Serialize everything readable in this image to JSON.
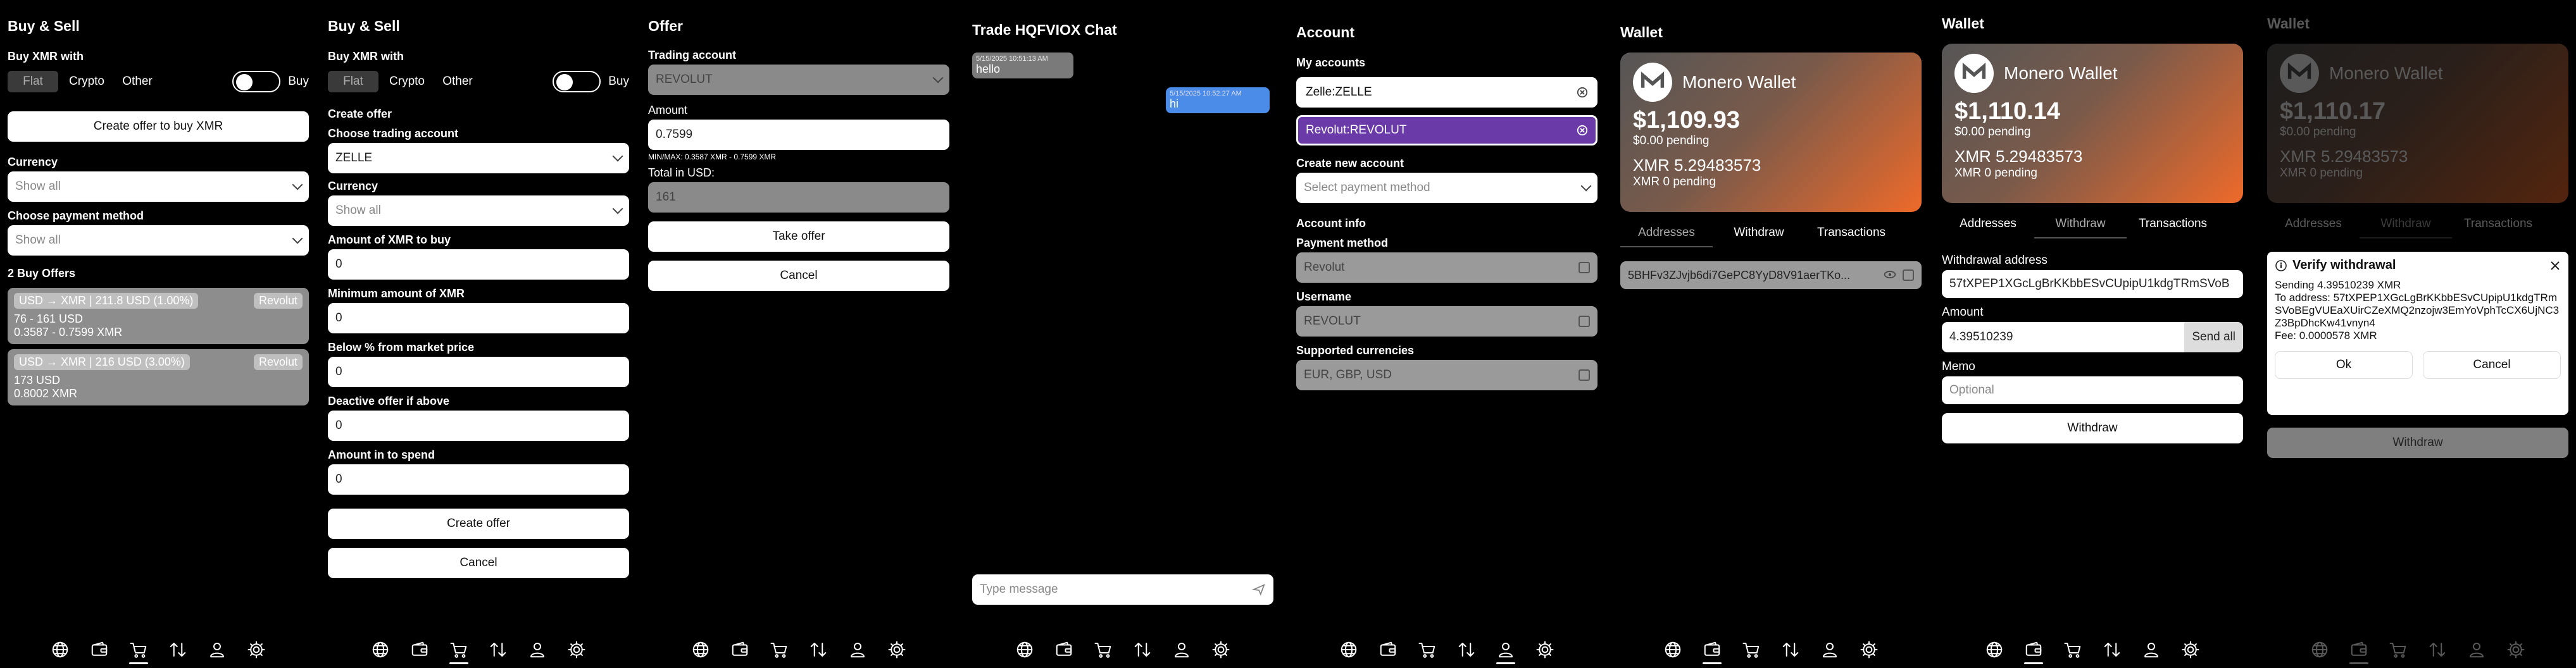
{
  "s1": {
    "title": "Buy & Sell",
    "buy_with": "Buy XMR with",
    "tabs": [
      "Flat",
      "Crypto",
      "Other"
    ],
    "toggle_label": "Buy",
    "create_btn": "Create offer to buy XMR",
    "currency_label": "Currency",
    "currency_value": "Show all",
    "payment_label": "Choose payment method",
    "payment_value": "Show all",
    "offers_title": "2 Buy Offers",
    "offers": [
      {
        "head": "USD → XMR | 211.8 USD (1.00%)",
        "method": "Revolut",
        "range": "76 - 161 USD",
        "xmr": "0.3587 - 0.7599 XMR"
      },
      {
        "head": "USD → XMR | 216 USD (3.00%)",
        "method": "Revolut",
        "range": "173 USD",
        "xmr": "0.8002 XMR"
      }
    ]
  },
  "s2": {
    "title": "Buy & Sell",
    "buy_with": "Buy XMR with",
    "tabs": [
      "Flat",
      "Crypto",
      "Other"
    ],
    "toggle_label": "Buy",
    "create_offer": "Create offer",
    "trading_label": "Choose trading account",
    "trading_value": "ZELLE",
    "currency_label": "Currency",
    "currency_value": "Show all",
    "amount_label": "Amount of XMR to buy",
    "amount_value": "0",
    "min_label": "Minimum amount of XMR",
    "min_value": "0",
    "below_label": "Below % from market price",
    "below_value": "0",
    "deact_label": "Deactive offer if above",
    "deact_value": "0",
    "spend_label": "Amount in to spend",
    "spend_value": "0",
    "create_btn": "Create offer",
    "cancel_btn": "Cancel"
  },
  "s3": {
    "title": "Offer",
    "trading_label": "Trading account",
    "trading_value": "REVOLUT",
    "amount_label": "Amount",
    "amount_value": "0.7599",
    "minmax": "MIN/MAX: 0.3587 XMR - 0.7599 XMR",
    "total_label": "Total in USD:",
    "total_value": "161",
    "take_btn": "Take offer",
    "cancel_btn": "Cancel"
  },
  "s4": {
    "title": "Trade HQFVIOX Chat",
    "msg1_time": "5/15/2025 10:51:13 AM",
    "msg1_text": "hello",
    "msg2_time": "5/15/2025 10:52:27 AM",
    "msg2_text": "hi",
    "input_placeholder": "Type message"
  },
  "s5": {
    "title": "Account",
    "my_accounts": "My accounts",
    "acc1": "Zelle:ZELLE",
    "acc2": "Revolut:REVOLUT",
    "new_label": "Create new account",
    "new_placeholder": "Select payment method",
    "info_label": "Account info",
    "pm_label": "Payment method",
    "pm_value": "Revolut",
    "user_label": "Username",
    "user_value": "REVOLUT",
    "cur_label": "Supported currencies",
    "cur_value": "EUR, GBP, USD",
    "accent": "#6a3aa8"
  },
  "s6": {
    "title": "Wallet",
    "card_title": "Monero Wallet",
    "usd": "$1,109.93",
    "usd_pending": "$0.00 pending",
    "xmr": "XMR 5.29483573",
    "xmr_pending": "XMR 0 pending",
    "tabs": [
      "Addresses",
      "Withdraw",
      "Transactions"
    ],
    "address": "5BHFv3ZJvjb6di7GePC8YyD8V91aerTKo..."
  },
  "s7": {
    "title": "Wallet",
    "card_title": "Monero Wallet",
    "usd": "$1,110.14",
    "usd_pending": "$0.00 pending",
    "xmr": "XMR 5.29483573",
    "xmr_pending": "XMR 0 pending",
    "tabs": [
      "Addresses",
      "Withdraw",
      "Transactions"
    ],
    "addr_label": "Withdrawal address",
    "addr_value": "57tXPEP1XGcLgBrKKbbESvCUpipU1kdgTRmSVoB",
    "amount_label": "Amount",
    "amount_value": "4.39510239",
    "send_all": "Send all",
    "memo_label": "Memo",
    "memo_placeholder": "Optional",
    "withdraw_btn": "Withdraw"
  },
  "s8": {
    "title": "Wallet",
    "card_title": "Monero Wallet",
    "usd": "$1,110.17",
    "usd_pending": "$0.00 pending",
    "xmr": "XMR 5.29483573",
    "xmr_pending": "XMR 0 pending",
    "tabs": [
      "Addresses",
      "Withdraw",
      "Transactions"
    ],
    "dialog_title": "Verify withdrawal",
    "dialog_line1": "Sending 4.39510239 XMR",
    "dialog_line2": "To address: 57tXPEP1XGcLgBrKKbbESvCUpipU1kdgTRmSVoBEgVUEaXUirCZeXMQ2nzojw3EmYoVphTcCX6UjNC3Z3BpDhcKw41vnyn4",
    "dialog_line3": "Fee: 0.0000578 XMR",
    "ok_btn": "Ok",
    "cancel_btn": "Cancel",
    "withdraw_btn": "Withdraw"
  },
  "icons": [
    "globe-icon",
    "wallet-icon",
    "cart-icon",
    "swap-icon",
    "user-icon",
    "gear-icon"
  ]
}
